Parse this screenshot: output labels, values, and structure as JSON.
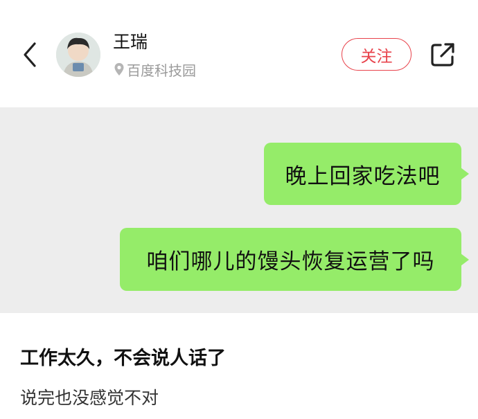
{
  "header": {
    "back_icon": "chevron-left-icon",
    "user_name": "王瑞",
    "location_icon": "location-pin-icon",
    "location": "百度科技园",
    "follow_label": "关注",
    "share_icon": "share-external-icon"
  },
  "chat": {
    "messages": [
      {
        "text": "晚上回家吃法吧"
      },
      {
        "text": "咱们哪儿的馒头恢复运营了吗"
      }
    ]
  },
  "post": {
    "title": "工作太久，不会说人话了",
    "subtitle": "说完也没感觉不对"
  },
  "colors": {
    "accent": "#e8424b",
    "bubble": "#95ec69",
    "chat_bg": "#ededed"
  }
}
